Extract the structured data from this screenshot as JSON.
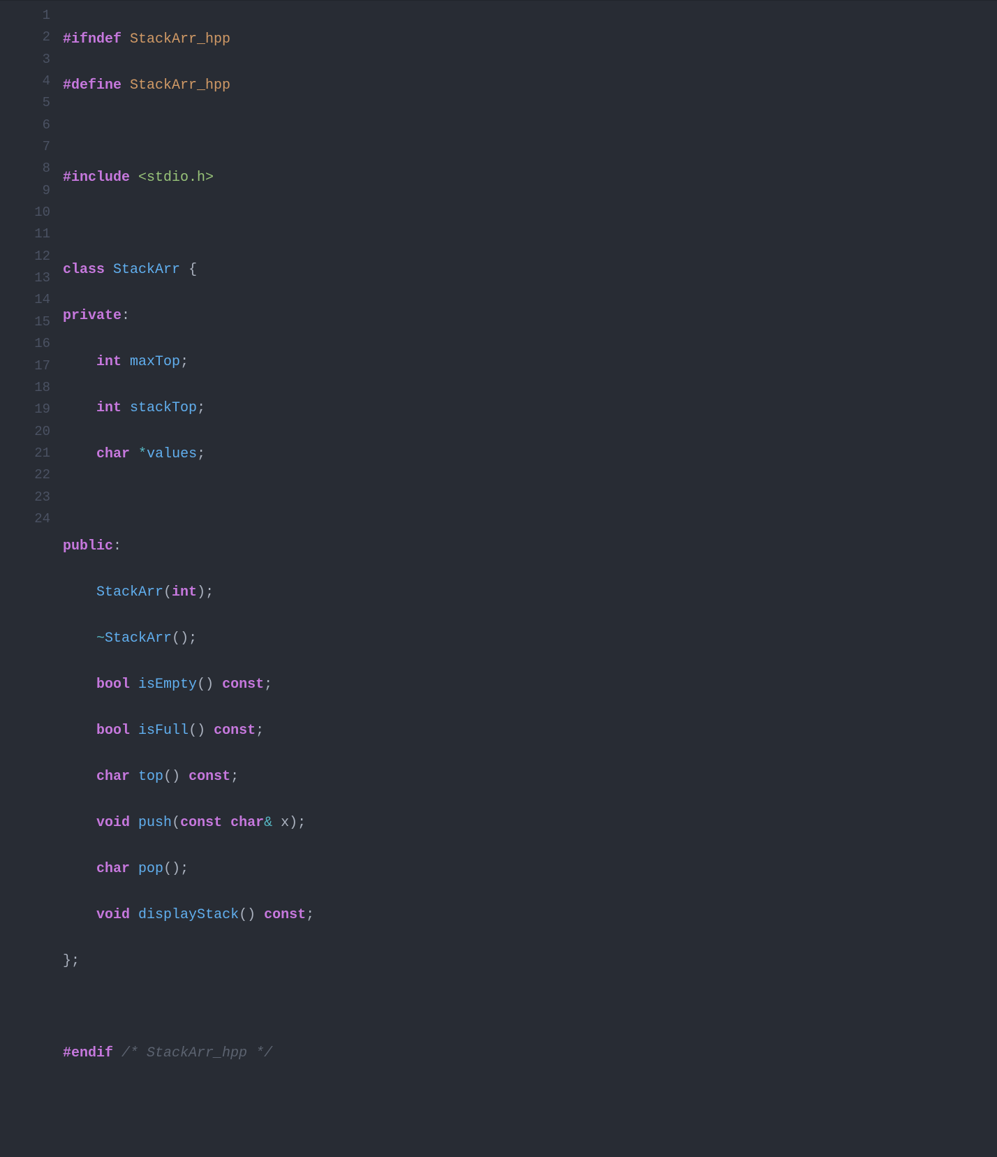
{
  "colors": {
    "background": "#282c34",
    "foreground": "#abb2bf",
    "gutter": "#4b5263",
    "keyword": "#c678dd",
    "macro": "#d19a66",
    "string": "#98c379",
    "type": "#61afef",
    "variable": "#e06c75",
    "operator": "#56b6c2",
    "comment": "#5c6370"
  },
  "lines": {
    "n1": "1",
    "n2": "2",
    "n3": "3",
    "n4": "4",
    "n5": "5",
    "n6": "6",
    "n7": "7",
    "n8": "8",
    "n9": "9",
    "n10": "10",
    "n11": "11",
    "n12": "12",
    "n13": "13",
    "n14": "14",
    "n15": "15",
    "n16": "16",
    "n17": "17",
    "n18": "18",
    "n19": "19",
    "n20": "20",
    "n21": "21",
    "n22": "22",
    "n23": "23",
    "n24": "24"
  },
  "t": {
    "ifndef": "#ifndef",
    "define": "#define",
    "include": "#include",
    "endif": "#endif",
    "macro": "StackArr_hpp",
    "incfile": "<stdio.h>",
    "class": "class",
    "className": "StackArr",
    "lbrace": "{",
    "rbraceSemi": "};",
    "private": "private",
    "public": "public",
    "colon": ":",
    "kw_int": "int",
    "kw_char": "char",
    "kw_bool": "bool",
    "kw_void": "void",
    "kw_const": "const",
    "var_maxTop": "maxTop",
    "var_stackTop": "stackTop",
    "var_values": "values",
    "star": "*",
    "amp": "&",
    "tilde": "~",
    "semi": ";",
    "lparen": "(",
    "rparen": ")",
    "ctor": "StackArr",
    "dtor": "StackArr",
    "fn_isEmpty": "isEmpty",
    "fn_isFull": "isFull",
    "fn_top": "top",
    "fn_push": "push",
    "fn_pop": "pop",
    "fn_displayStack": "displayStack",
    "param_x": " x",
    "space": " ",
    "sp4": "    ",
    "endcomment": "/* StackArr_hpp */"
  }
}
